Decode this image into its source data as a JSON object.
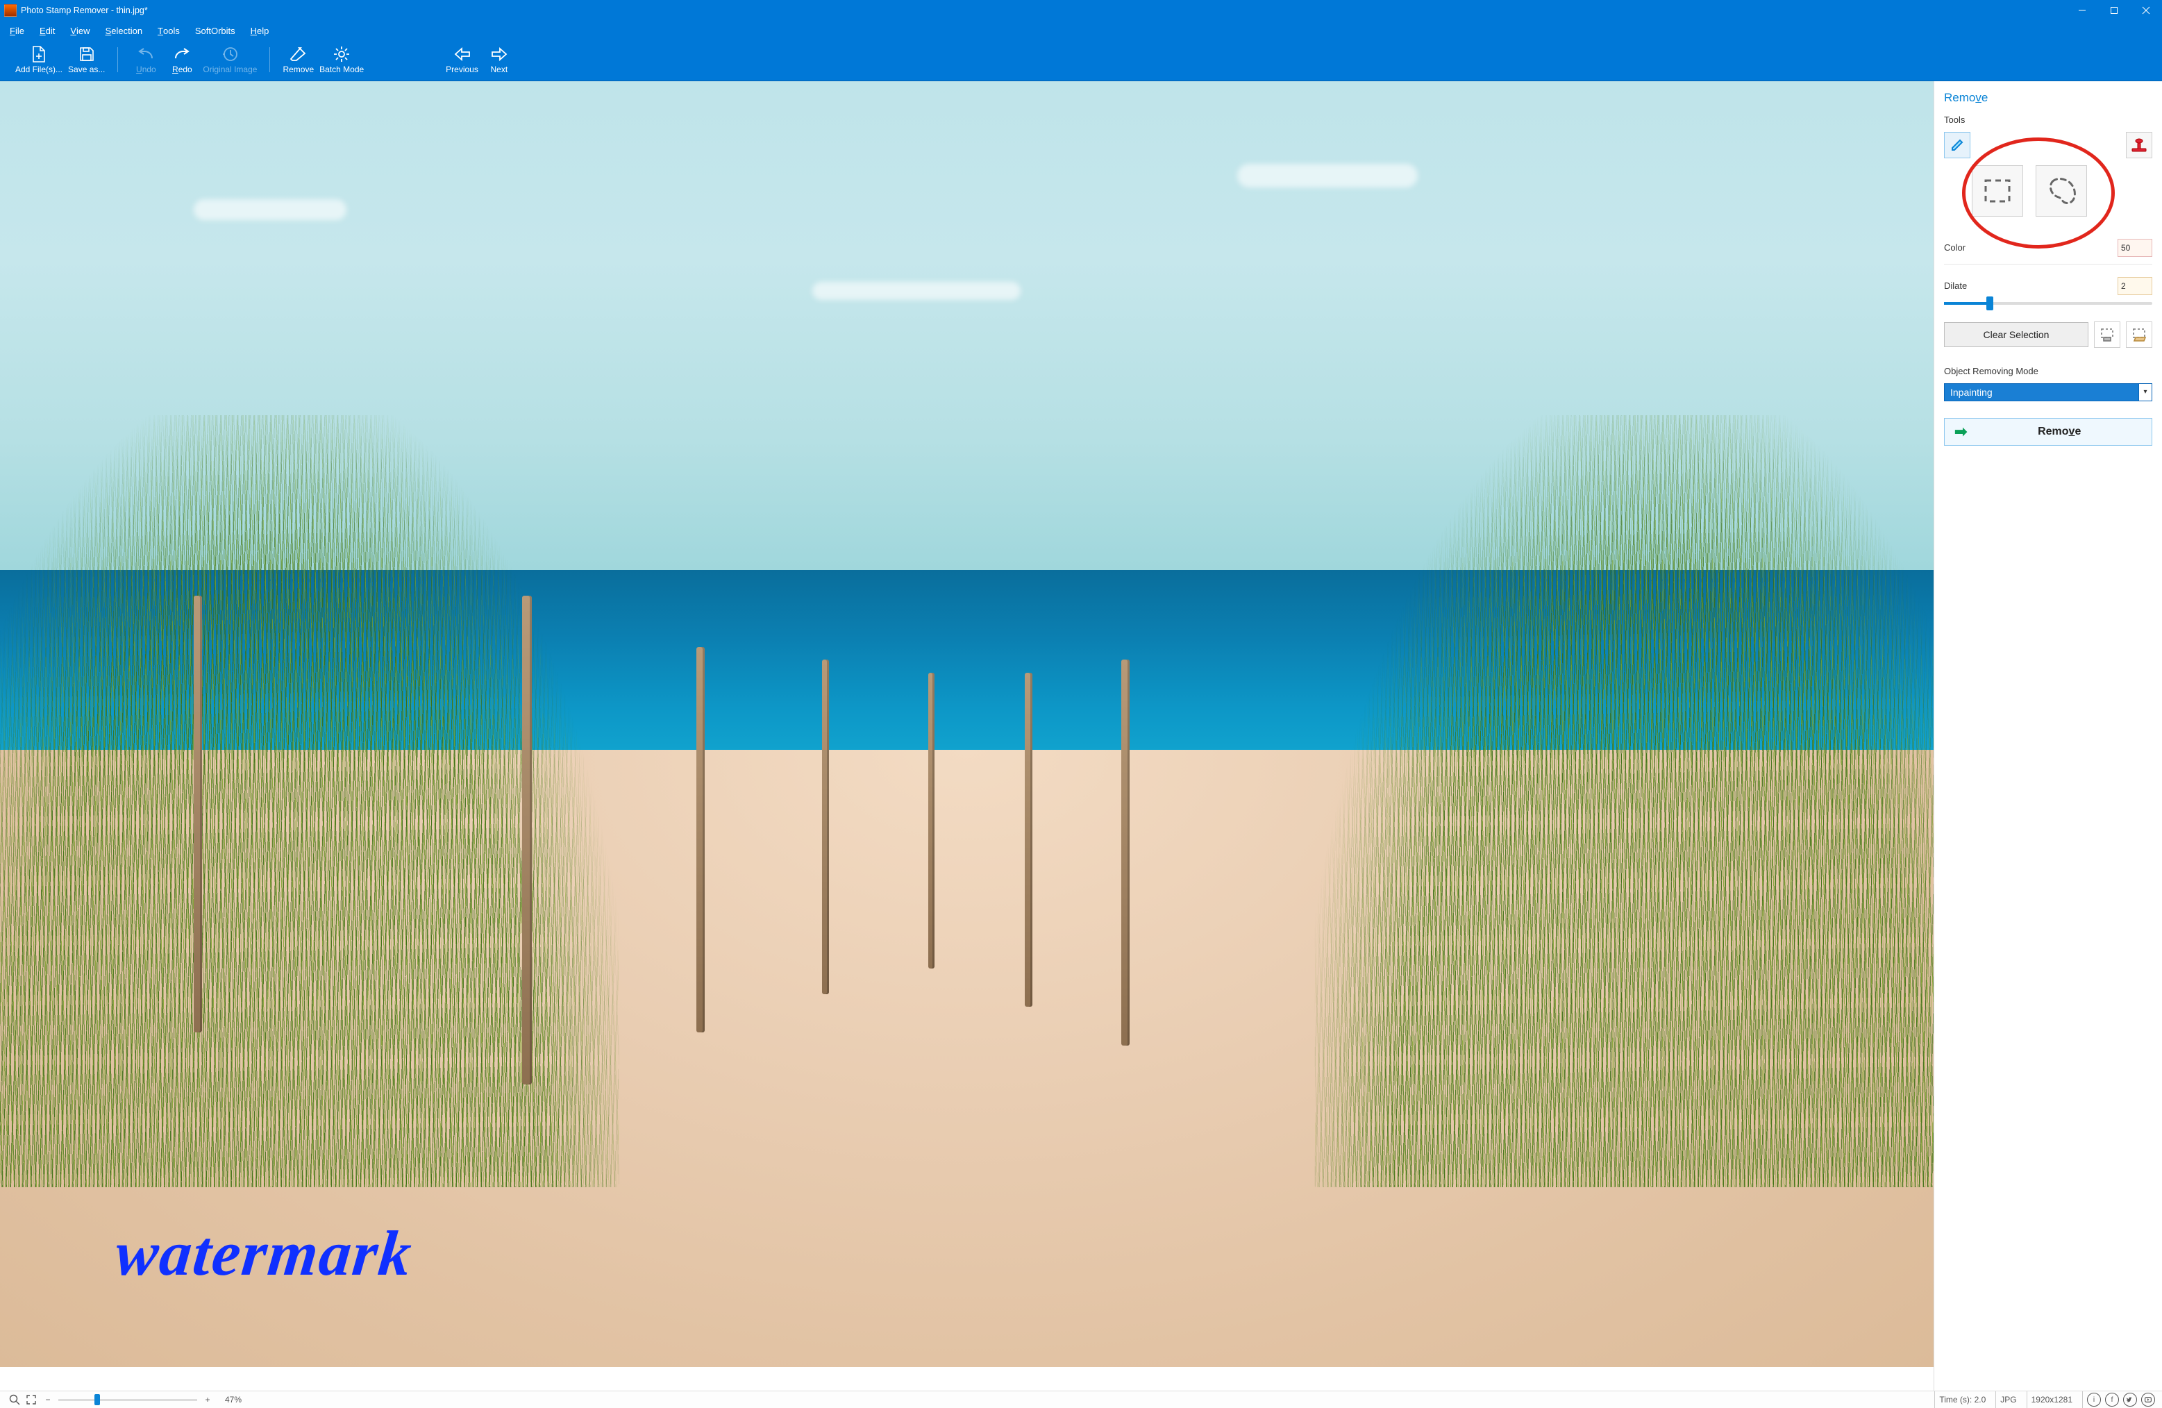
{
  "window": {
    "title": "Photo Stamp Remover - thin.jpg*"
  },
  "menubar": {
    "file": "File",
    "edit": "Edit",
    "view": "View",
    "selection": "Selection",
    "tools": "Tools",
    "softorbits": "SoftOrbits",
    "help": "Help"
  },
  "toolbar": {
    "add_files": "Add File(s)...",
    "save_as": "Save as...",
    "undo": "Undo",
    "redo": "Redo",
    "original_image": "Original Image",
    "remove": "Remove",
    "batch_mode": "Batch Mode",
    "previous": "Previous",
    "next": "Next"
  },
  "image": {
    "watermark_text": "watermark"
  },
  "side": {
    "heading_prefix": "Remo",
    "heading_ul": "v",
    "heading_suffix": "e",
    "tools_label": "Tools",
    "color_label": "Color",
    "color_value": "50",
    "dilate_label": "Dilate",
    "dilate_value": "2",
    "clear_prefix": "",
    "clear_ul": "C",
    "clear_suffix": "lear Selection",
    "mode_label": "Object Removing Mode",
    "mode_value": "Inpainting",
    "remove_prefix": "Remo",
    "remove_ul": "v",
    "remove_suffix": "e"
  },
  "status": {
    "zoom_pct": "47%",
    "time": "Time (s): 2.0",
    "format": "JPG",
    "dims": "1920x1281"
  }
}
